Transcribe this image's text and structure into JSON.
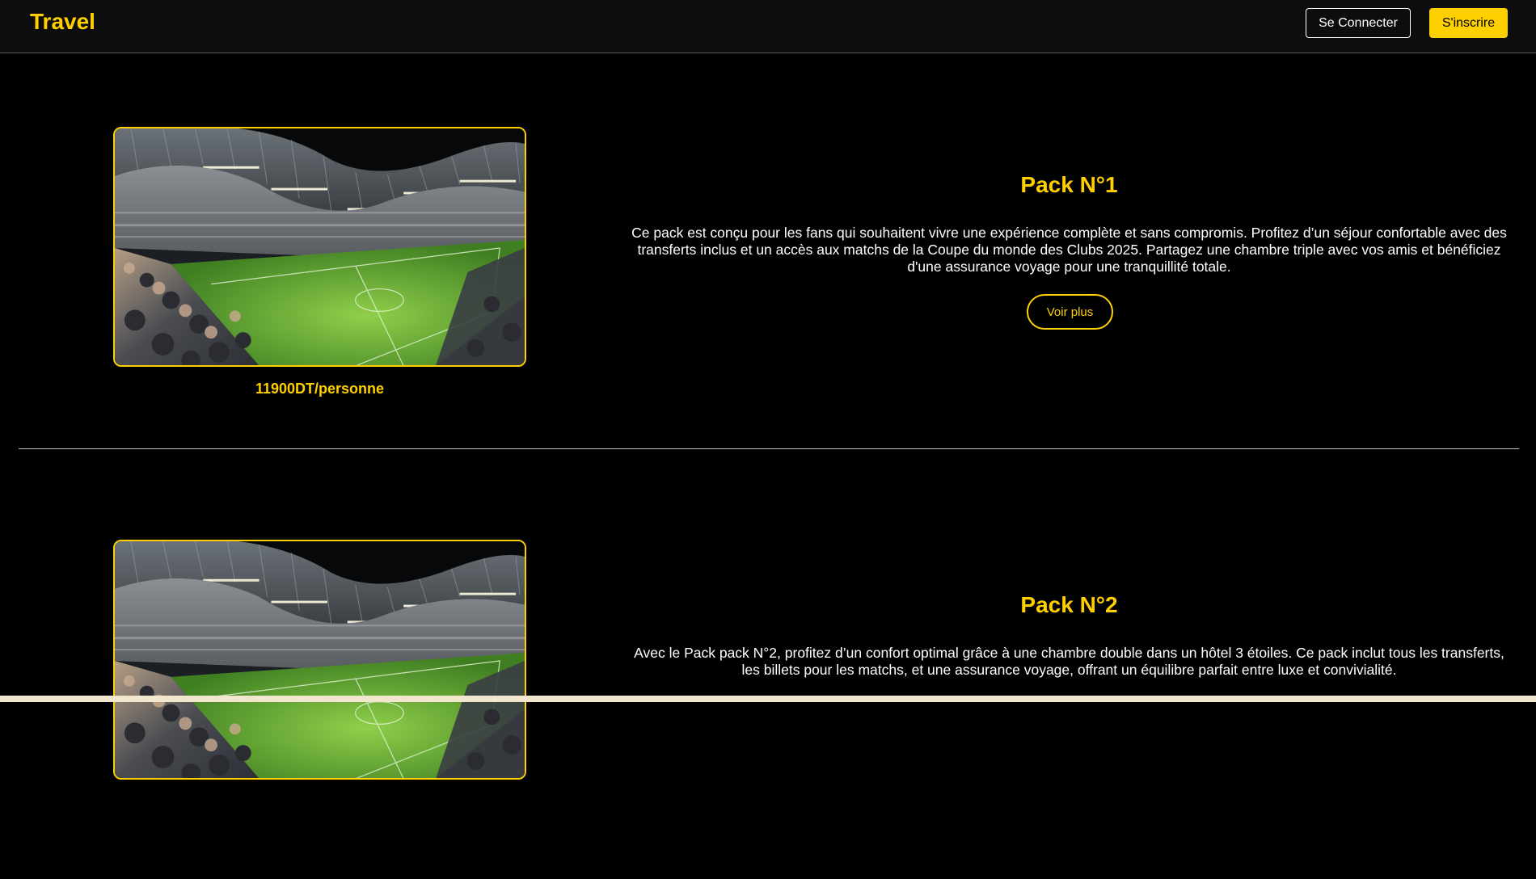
{
  "header": {
    "brand": "Travel",
    "login_label": "Se Connecter",
    "signup_label": "S'inscrire"
  },
  "packs": [
    {
      "title": "Pack N°1",
      "description": "Ce pack est conçu pour les fans qui souhaitent vivre une expérience complète et sans compromis. Profitez d’un séjour confortable avec des transferts inclus et un accès aux matchs de la Coupe du monde des Clubs 2025. Partagez une chambre triple avec vos amis et bénéficiez d'une assurance voyage pour une tranquillité totale.",
      "button_label": "Voir plus",
      "price": "11900DT/personne"
    },
    {
      "title": "Pack N°2",
      "description": "Avec le Pack pack N°2, profitez d’un confort optimal grâce à une chambre double dans un hôtel 3 étoiles. Ce pack inclut tous les transferts, les billets pour les matchs, et une assurance voyage, offrant un équilibre parfait entre luxe et convivialité."
    }
  ],
  "colors": {
    "accent": "#ffd000",
    "background": "#000000",
    "navbar": "#0d0d0d"
  }
}
